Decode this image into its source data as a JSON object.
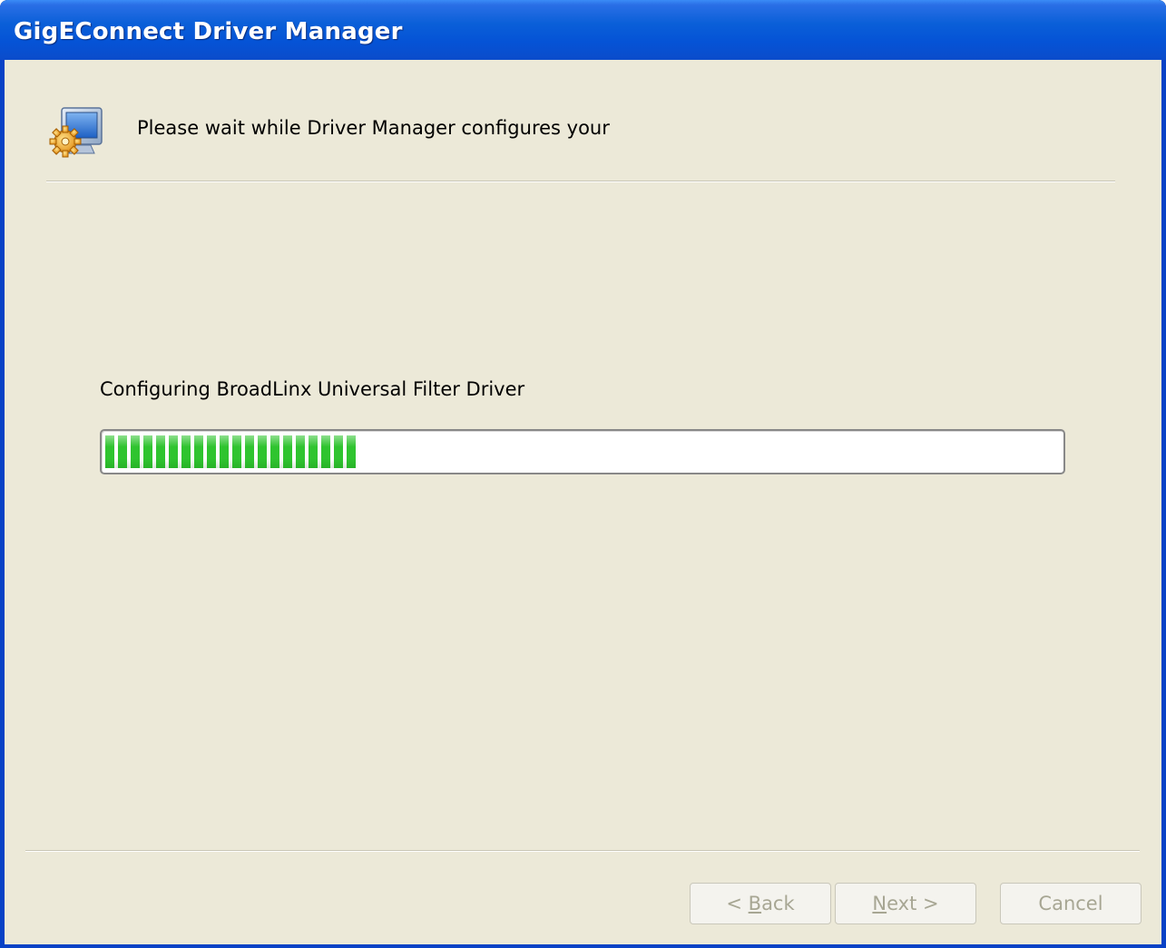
{
  "window": {
    "title": "GigEConnect Driver Manager"
  },
  "header": {
    "icon": "computer-gear-icon",
    "text": "Please wait while Driver Manager configures your"
  },
  "status": {
    "label": "Configuring BroadLinx Universal Filter Driver",
    "progress": 0.26,
    "progress_color": "#2fc42f"
  },
  "buttons": {
    "back": {
      "prefix": "< ",
      "mnemonic": "B",
      "rest": "ack",
      "enabled": false
    },
    "next": {
      "mnemonic": "N",
      "rest": "ext",
      "suffix": " >",
      "enabled": false
    },
    "cancel": {
      "label": "Cancel",
      "enabled": false
    }
  },
  "colors": {
    "client_bg": "#ece9d8",
    "titlebar": "#0553d6",
    "disabled_text": "#a7a693"
  }
}
